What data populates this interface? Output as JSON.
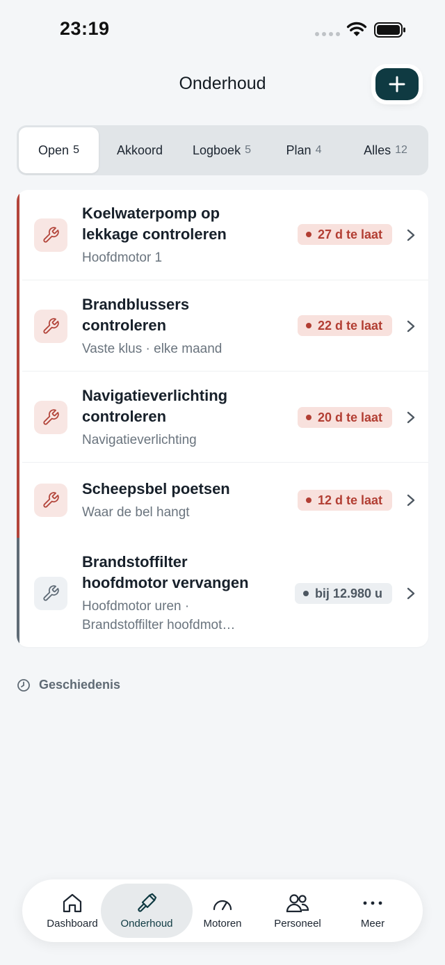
{
  "status_bar": {
    "time": "23:19"
  },
  "header": {
    "title": "Onderhoud",
    "add_button_icon": "plus-icon"
  },
  "tabs": [
    {
      "label": "Open",
      "count": "5",
      "active": true
    },
    {
      "label": "Akkoord",
      "count": "",
      "active": false
    },
    {
      "label": "Logboek",
      "count": "5",
      "active": false
    },
    {
      "label": "Plan",
      "count": "4",
      "active": false
    },
    {
      "label": "Alles",
      "count": "12",
      "active": false
    }
  ],
  "tasks": [
    {
      "title": "Koelwaterpomp op lekkage controleren",
      "subtitle": "Hoofdmotor 1",
      "badge": "27 d te laat",
      "status": "overdue",
      "icon": "wrench-icon"
    },
    {
      "title": "Brandblussers controleren",
      "subtitle": "Vaste klus · elke maand",
      "badge": "22 d te laat",
      "status": "overdue",
      "icon": "wrench-icon"
    },
    {
      "title": "Navigatieverlichting controleren",
      "subtitle": "Navigatieverlichting",
      "badge": "20 d te laat",
      "status": "overdue",
      "icon": "wrench-icon"
    },
    {
      "title": "Scheepsbel poetsen",
      "subtitle": "Waar de bel hangt",
      "badge": "12 d te laat",
      "status": "overdue",
      "icon": "wrench-icon"
    },
    {
      "title": "Brandstoffilter hoofdmotor vervangen",
      "subtitle": "Hoofdmotor uren · Brandstoffilter hoofdmot…",
      "badge": "bij 12.980 u",
      "status": "scheduled",
      "icon": "wrench-icon"
    }
  ],
  "history": {
    "label": "Geschiedenis",
    "icon": "clock-icon"
  },
  "bottom_nav": [
    {
      "label": "Dashboard",
      "icon": "home-icon",
      "active": false
    },
    {
      "label": "Onderhoud",
      "icon": "hammer-icon",
      "active": true
    },
    {
      "label": "Motoren",
      "icon": "gauge-icon",
      "active": false
    },
    {
      "label": "Personeel",
      "icon": "people-icon",
      "active": false
    },
    {
      "label": "Meer",
      "icon": "more-icon",
      "active": false
    }
  ],
  "colors": {
    "accent": "#0f3a42",
    "overdue": "#b3453b",
    "neutral": "#5f6b76",
    "background": "#f4f6f8"
  }
}
